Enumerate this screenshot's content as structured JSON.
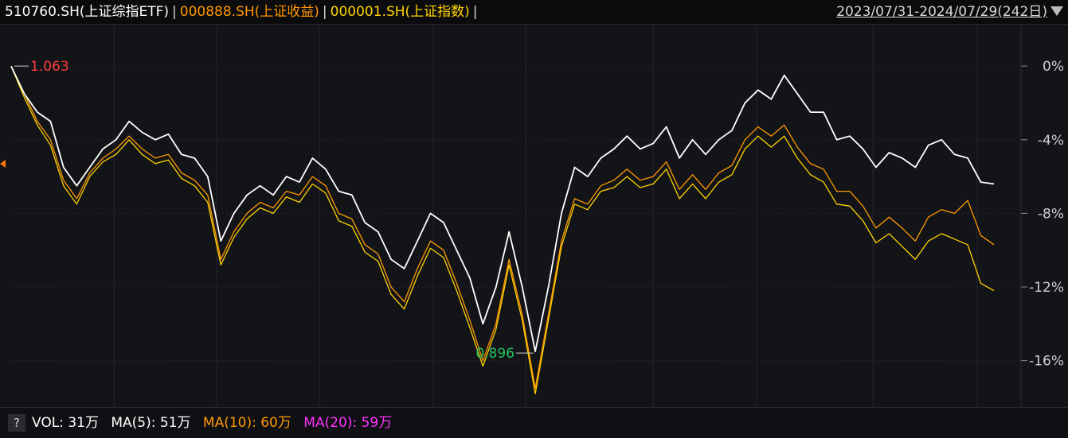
{
  "header": {
    "series_labels": [
      {
        "text": "510760.SH(上证综指ETF)",
        "color": "#ffffff"
      },
      {
        "text": "000888.SH(上证收益)",
        "color": "#ff9900"
      },
      {
        "text": "000001.SH(上证指数)",
        "color": "#ffd400"
      }
    ],
    "separator": "|",
    "date_range": "2023/07/31-2024/07/29(242日)",
    "dropdown_icon": "triangle-down-icon"
  },
  "annotations": {
    "high_label": "1.063",
    "low_label": "0.896"
  },
  "footer": {
    "help_label": "?",
    "vol": "VOL: 31万",
    "ma5": "MA(5): 51万",
    "ma10": "MA(10): 60万",
    "ma20": "MA(20): 59万"
  },
  "chart_data": {
    "type": "line",
    "yaxis_ticks": [
      "0%",
      "-4%",
      "-8%",
      "-12%",
      "-16%"
    ],
    "ylim": [
      -18,
      1
    ],
    "grid": true,
    "series": [
      {
        "name": "510760.SH(上证综指ETF)",
        "color": "#ffffff",
        "values": [
          0,
          -1.5,
          -2.5,
          -3,
          -5.5,
          -6.5,
          -5.5,
          -4.5,
          -4,
          -3,
          -3.6,
          -4,
          -3.7,
          -4.8,
          -5,
          -6,
          -9.5,
          -8,
          -7,
          -6.5,
          -7,
          -6,
          -6.3,
          -5,
          -5.6,
          -6.8,
          -7,
          -8.5,
          -9,
          -10.5,
          -11,
          -9.5,
          -8,
          -8.5,
          -10,
          -11.5,
          -14,
          -12,
          -9,
          -12,
          -15.5,
          -12,
          -8,
          -5.5,
          -6,
          -5,
          -4.5,
          -3.8,
          -4.5,
          -4.2,
          -3.3,
          -5,
          -4,
          -4.8,
          -4,
          -3.5,
          -2,
          -1.3,
          -1.8,
          -0.5,
          -1.5,
          -2.5,
          -2.5,
          -4,
          -3.8,
          -4.5,
          -5.5,
          -4.7,
          -5,
          -5.5,
          -4.3,
          -4,
          -4.8,
          -5,
          -6.3,
          -6.4
        ]
      },
      {
        "name": "000888.SH(上证收益)",
        "color": "#ff9900",
        "values": [
          0,
          -1.5,
          -3,
          -4,
          -6.2,
          -7.2,
          -5.8,
          -5,
          -4.5,
          -3.8,
          -4.5,
          -5,
          -4.8,
          -5.8,
          -6.2,
          -7,
          -10.5,
          -9,
          -8,
          -7.4,
          -7.7,
          -6.8,
          -7,
          -6,
          -6.5,
          -8,
          -8.3,
          -9.7,
          -10.2,
          -12,
          -12.8,
          -11,
          -9.5,
          -10,
          -11.8,
          -13.8,
          -16,
          -14,
          -10.5,
          -13.5,
          -17.5,
          -13.5,
          -9.5,
          -7.2,
          -7.5,
          -6.5,
          -6.2,
          -5.6,
          -6.2,
          -6,
          -5.2,
          -6.7,
          -5.9,
          -6.7,
          -5.8,
          -5.4,
          -4,
          -3.3,
          -3.8,
          -3.2,
          -4.4,
          -5.3,
          -5.6,
          -6.8,
          -6.8,
          -7.6,
          -8.8,
          -8.2,
          -8.8,
          -9.5,
          -8.2,
          -7.8,
          -8,
          -7.3,
          -9.2,
          -9.7
        ]
      },
      {
        "name": "000001.SH(上证指数)",
        "color": "#ffd400",
        "values": [
          0,
          -1.7,
          -3.2,
          -4.3,
          -6.5,
          -7.5,
          -6,
          -5.2,
          -4.8,
          -4,
          -4.8,
          -5.3,
          -5.1,
          -6.1,
          -6.5,
          -7.4,
          -10.8,
          -9.3,
          -8.3,
          -7.7,
          -8,
          -7.1,
          -7.4,
          -6.4,
          -6.9,
          -8.4,
          -8.7,
          -10.1,
          -10.6,
          -12.4,
          -13.2,
          -11.4,
          -9.9,
          -10.4,
          -12.2,
          -14.2,
          -16.3,
          -14.3,
          -10.8,
          -13.8,
          -17.8,
          -13.8,
          -9.8,
          -7.5,
          -7.8,
          -6.8,
          -6.6,
          -6,
          -6.6,
          -6.4,
          -5.6,
          -7.2,
          -6.4,
          -7.2,
          -6.3,
          -5.9,
          -4.5,
          -3.8,
          -4.4,
          -3.8,
          -5,
          -5.9,
          -6.3,
          -7.5,
          -7.6,
          -8.4,
          -9.6,
          -9.1,
          -9.8,
          -10.5,
          -9.5,
          -9.1,
          -9.4,
          -9.7,
          -11.8,
          -12.2
        ]
      }
    ]
  }
}
